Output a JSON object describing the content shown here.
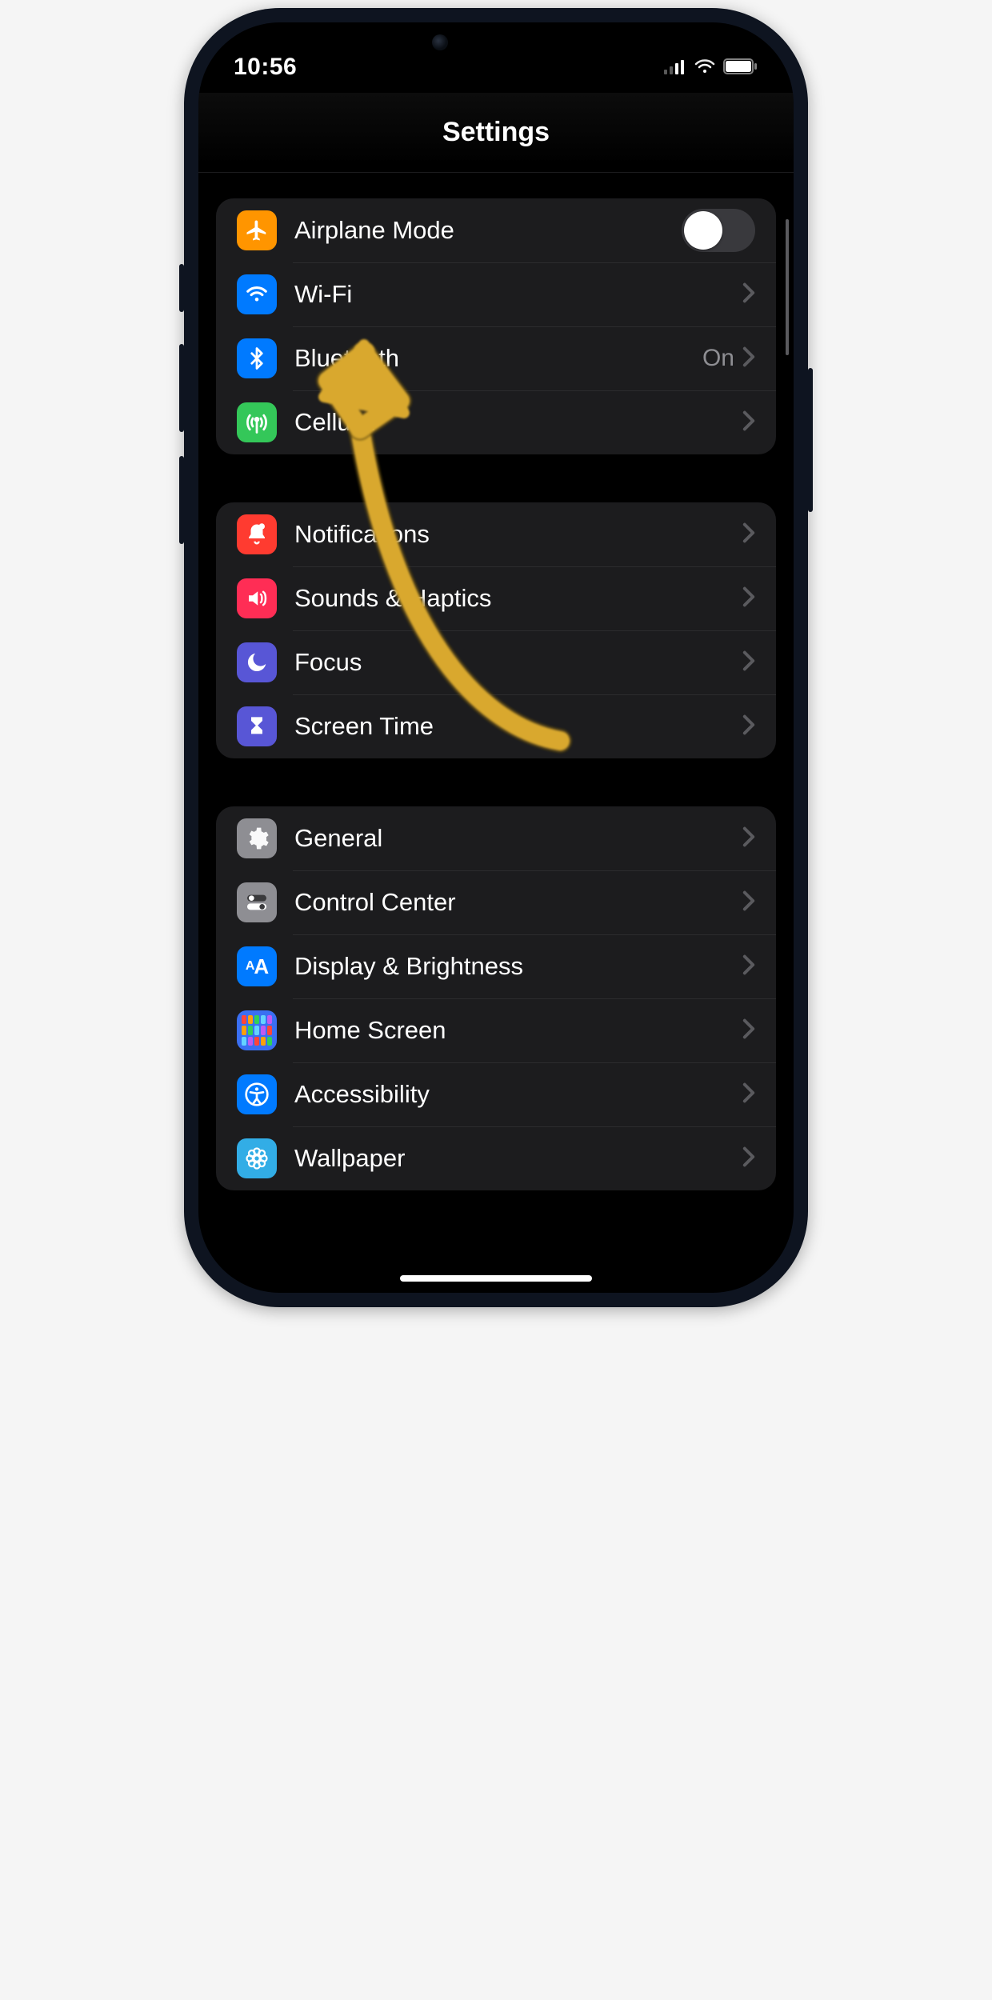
{
  "status": {
    "time": "10:56"
  },
  "nav": {
    "title": "Settings"
  },
  "groups": [
    {
      "rows": [
        {
          "id": "airplane",
          "label": "Airplane Mode",
          "icon": "airplane-icon",
          "icon_bg": "bg-orange",
          "accessory": "toggle",
          "toggle_on": false
        },
        {
          "id": "wifi",
          "label": "Wi-Fi",
          "icon": "wifi-icon",
          "icon_bg": "bg-blue",
          "accessory": "disclosure",
          "value": ""
        },
        {
          "id": "bluetooth",
          "label": "Bluetooth",
          "icon": "bluetooth-icon",
          "icon_bg": "bg-blue",
          "accessory": "disclosure",
          "value": "On"
        },
        {
          "id": "cellular",
          "label": "Cellular",
          "icon": "antenna-icon",
          "icon_bg": "bg-green",
          "accessory": "disclosure",
          "value": ""
        }
      ]
    },
    {
      "rows": [
        {
          "id": "notifications",
          "label": "Notifications",
          "icon": "bell-icon",
          "icon_bg": "bg-red",
          "accessory": "disclosure"
        },
        {
          "id": "sounds",
          "label": "Sounds & Haptics",
          "icon": "speaker-icon",
          "icon_bg": "bg-pink",
          "accessory": "disclosure"
        },
        {
          "id": "focus",
          "label": "Focus",
          "icon": "moon-icon",
          "icon_bg": "bg-indigo",
          "accessory": "disclosure"
        },
        {
          "id": "screentime",
          "label": "Screen Time",
          "icon": "hourglass-icon",
          "icon_bg": "bg-indigo",
          "accessory": "disclosure"
        }
      ]
    },
    {
      "rows": [
        {
          "id": "general",
          "label": "General",
          "icon": "gear-icon",
          "icon_bg": "bg-gray",
          "accessory": "disclosure"
        },
        {
          "id": "controlcenter",
          "label": "Control Center",
          "icon": "toggles-icon",
          "icon_bg": "bg-gray",
          "accessory": "disclosure"
        },
        {
          "id": "display",
          "label": "Display & Brightness",
          "icon": "aa-icon",
          "icon_bg": "bg-blue",
          "accessory": "disclosure"
        },
        {
          "id": "homescreen",
          "label": "Home Screen",
          "icon": "homescreen-icon",
          "icon_bg": "bg-home",
          "accessory": "disclosure"
        },
        {
          "id": "accessibility",
          "label": "Accessibility",
          "icon": "accessibility-icon",
          "icon_bg": "bg-blue",
          "accessory": "disclosure"
        },
        {
          "id": "wallpaper",
          "label": "Wallpaper",
          "icon": "flower-icon",
          "icon_bg": "bg-cyan",
          "accessory": "disclosure"
        }
      ]
    }
  ],
  "annotation": {
    "type": "arrow",
    "color": "#d9a82e",
    "points_to": "bluetooth"
  }
}
